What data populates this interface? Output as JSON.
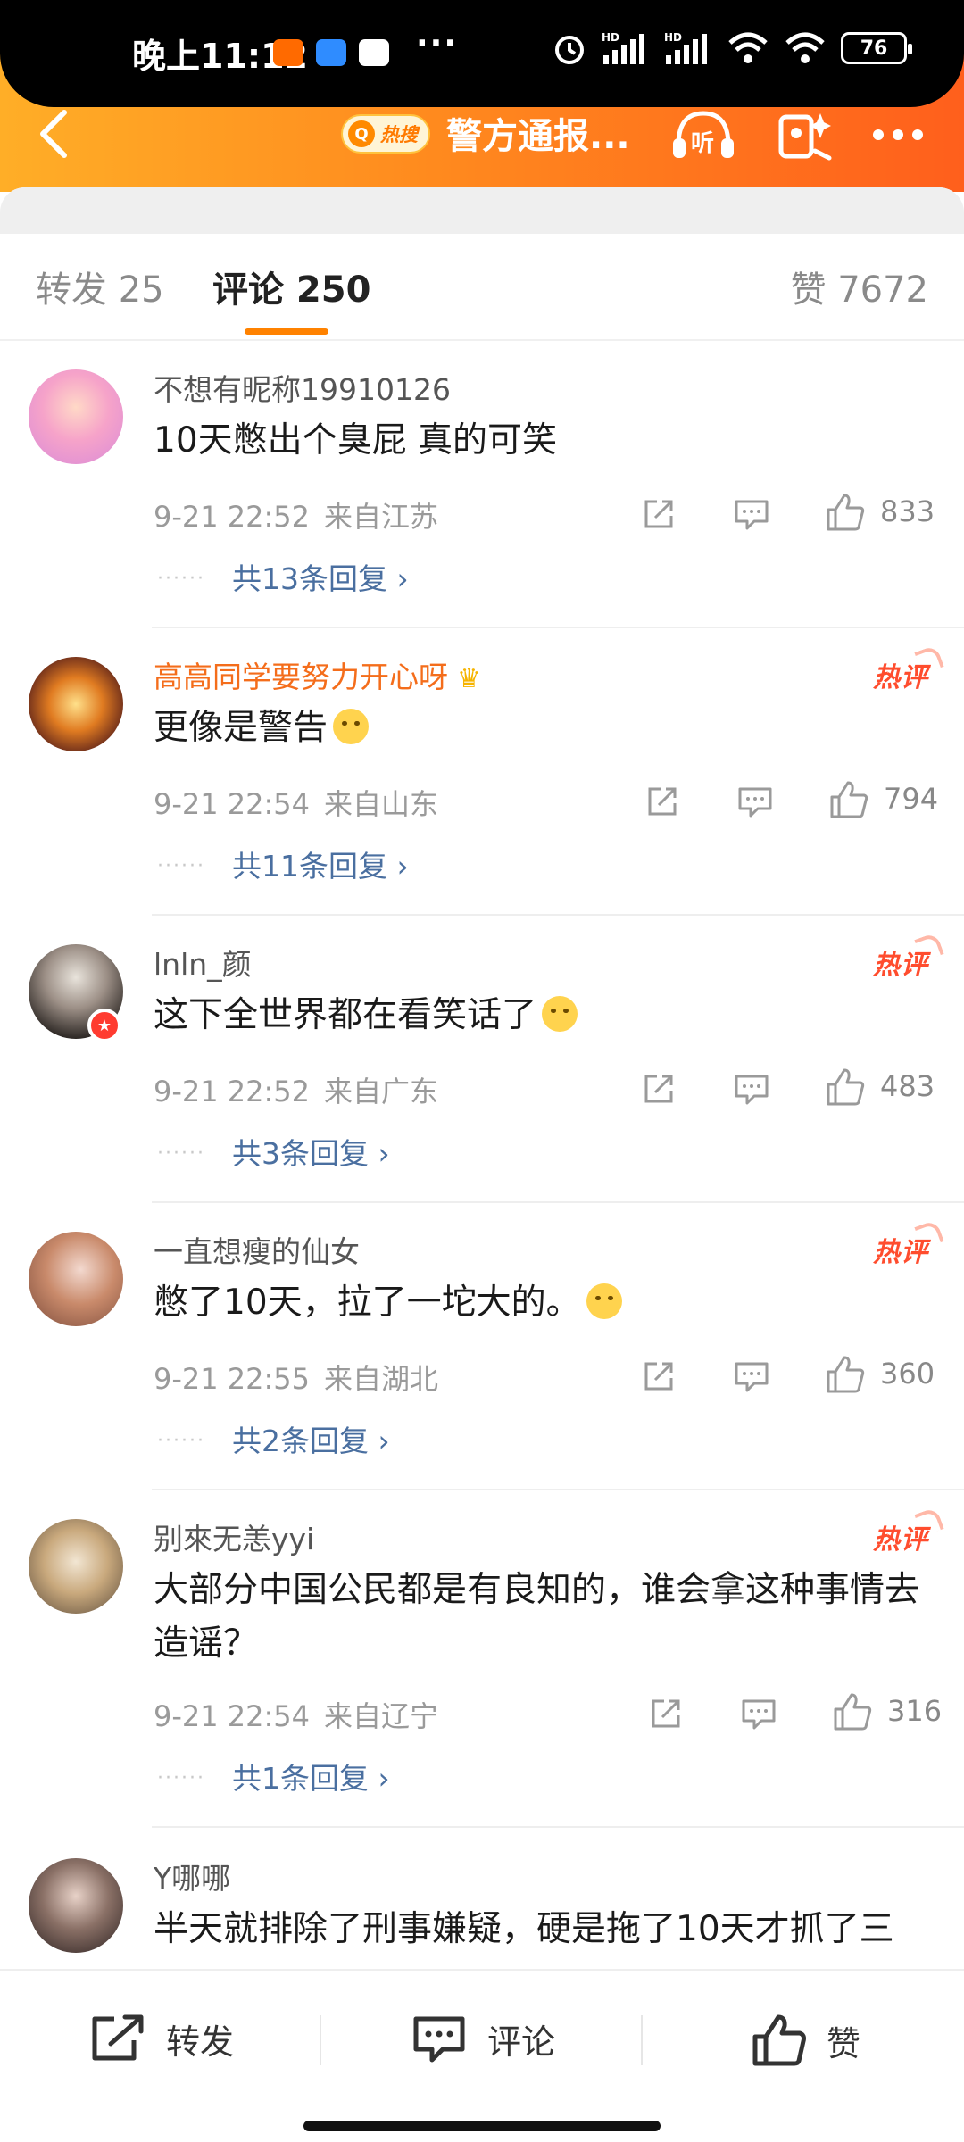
{
  "status_bar": {
    "time": "晚上11:12",
    "battery": "76",
    "network_1": "HD",
    "network_2": "HD"
  },
  "header": {
    "hot_tag": "热搜",
    "title": "警方通报..."
  },
  "tabs": {
    "repost": "转发 25",
    "comments": "评论 250",
    "likes": "赞 7672"
  },
  "comments": [
    {
      "name": "不想有昵称19910126",
      "text": "10天憋出个臭屁 真的可笑",
      "time": "9-21 22:52",
      "location": "来自江苏",
      "likes": "833",
      "replies": "共13条回复 ›",
      "hot": ""
    },
    {
      "name": "高高同学要努力开心呀",
      "text": "更像是警告",
      "time": "9-21 22:54",
      "location": "来自山东",
      "likes": "794",
      "replies": "共11条回复 ›",
      "hot": "热评"
    },
    {
      "name": "lnln_颜",
      "text": "这下全世界都在看笑话了",
      "time": "9-21 22:52",
      "location": "来自广东",
      "likes": "483",
      "replies": "共3条回复 ›",
      "hot": "热评"
    },
    {
      "name": "一直想瘦的仙女",
      "text": "憋了10天，拉了一坨大的。",
      "time": "9-21 22:55",
      "location": "来自湖北",
      "likes": "360",
      "replies": "共2条回复 ›",
      "hot": "热评"
    },
    {
      "name": "别來无恙yyi",
      "text": "大部分中国公民都是有良知的，谁会拿这种事情去造谣？",
      "time": "9-21 22:54",
      "location": "来自辽宁",
      "likes": "316",
      "replies": "共1条回复 ›",
      "hot": "热评"
    },
    {
      "name": "Y哪哪",
      "text": "半天就排除了刑事嫌疑，硬是拖了10天才抓了三",
      "time": "",
      "location": "",
      "likes": "",
      "replies": "",
      "hot": ""
    }
  ],
  "bottom_bar": {
    "repost": "转发",
    "comment": "评论",
    "like": "赞"
  },
  "colors": {
    "brand_orange": "#ff8200",
    "hot_red": "#ff4d2e",
    "link_blue": "#4a6fa0"
  }
}
